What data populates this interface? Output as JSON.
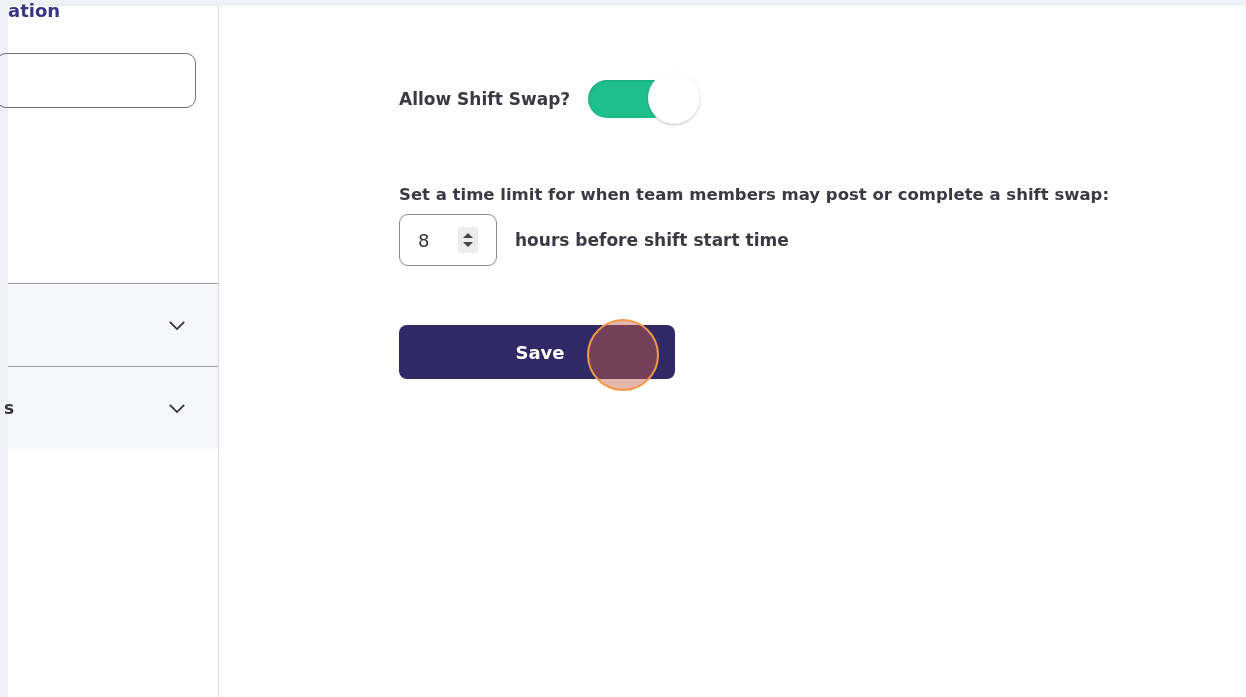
{
  "sidebar": {
    "heading": "ation",
    "sections": [
      {
        "expanded": false
      },
      {
        "label": "s",
        "expanded": false
      }
    ]
  },
  "settings": {
    "allow_shift_swap": {
      "label": "Allow Shift Swap?",
      "on": true
    },
    "time_limit": {
      "prompt": "Set a time limit for when team members may post or complete a shift swap:",
      "value": "8",
      "suffix": "hours before shift start time"
    },
    "save_button": {
      "label": "Save"
    }
  },
  "click_indicator": {
    "shown": true
  }
}
